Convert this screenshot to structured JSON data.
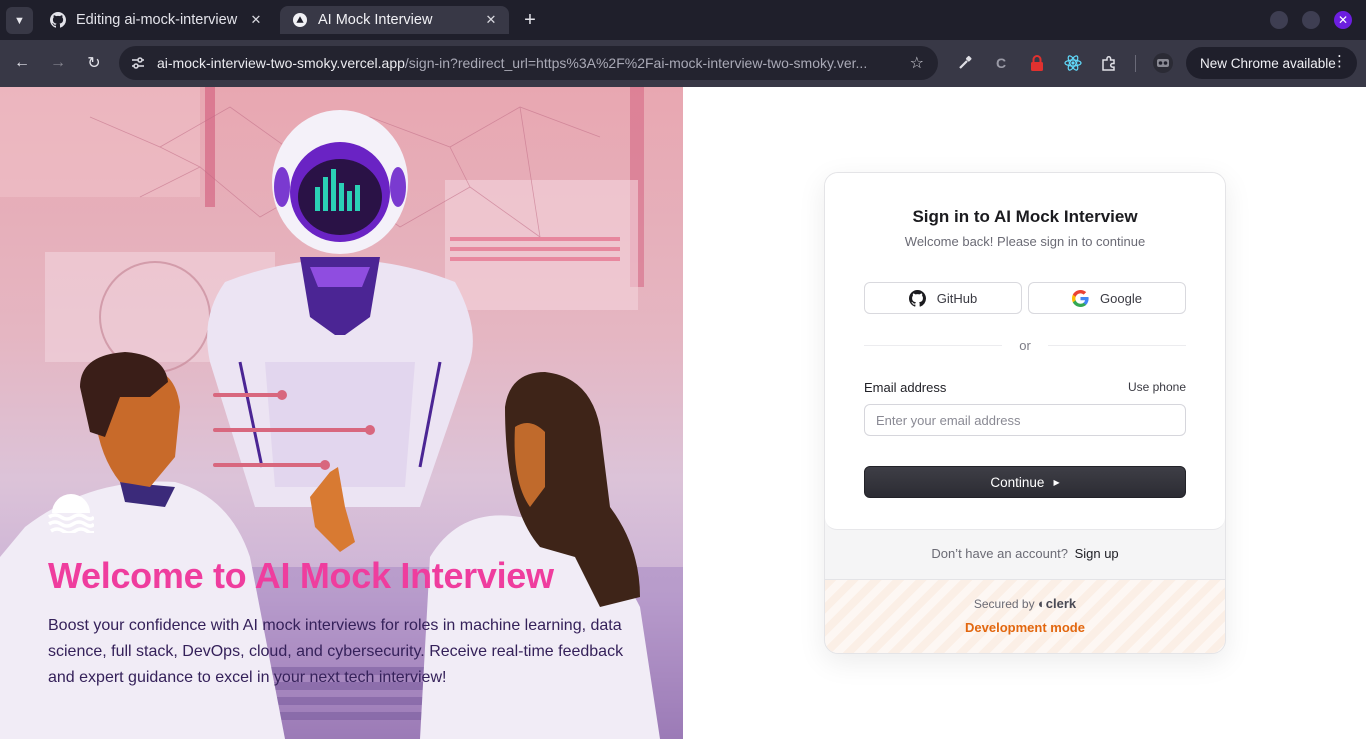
{
  "browser": {
    "tabs": [
      {
        "title": "Editing ai-mock-interview",
        "icon": "github-icon",
        "active": false
      },
      {
        "title": "AI Mock Interview",
        "icon": "vercel-triangle-icon",
        "active": true
      }
    ],
    "url_host": "ai-mock-interview-two-smoky.vercel.app",
    "url_rest": "/sign-in?redirect_url=https%3A%2F%2Fai-mock-interview-two-smoky.ver...",
    "update_label": "New Chrome available",
    "colors": {
      "tabbar": "#1f1f2b",
      "toolbar": "#383846",
      "accent": "#6c1ee0"
    }
  },
  "hero": {
    "title": "Welcome to AI Mock Interview",
    "description": "Boost your confidence with AI mock interviews for roles in machine learning, data science, full stack, DevOps, cloud, and cybersecurity. Receive real-time feedback and expert guidance to excel in your next tech interview!",
    "logo": "wave-logo-icon",
    "colors": {
      "title": "#ef3d9e",
      "text": "#35215a"
    }
  },
  "signin": {
    "title": "Sign in to AI Mock Interview",
    "subtitle": "Welcome back! Please sign in to continue",
    "github_label": "GitHub",
    "google_label": "Google",
    "or_label": "or",
    "email_label": "Email address",
    "use_phone_label": "Use phone",
    "email_placeholder": "Enter your email address",
    "email_value": "",
    "continue_label": "Continue",
    "no_account_text": "Don’t have an account?",
    "signup_label": "Sign up",
    "secured_text": "Secured by",
    "clerk_label": "clerk",
    "dev_mode_label": "Development mode",
    "colors": {
      "dev_mode": "#e2670f",
      "button": "#2f2f36"
    }
  }
}
